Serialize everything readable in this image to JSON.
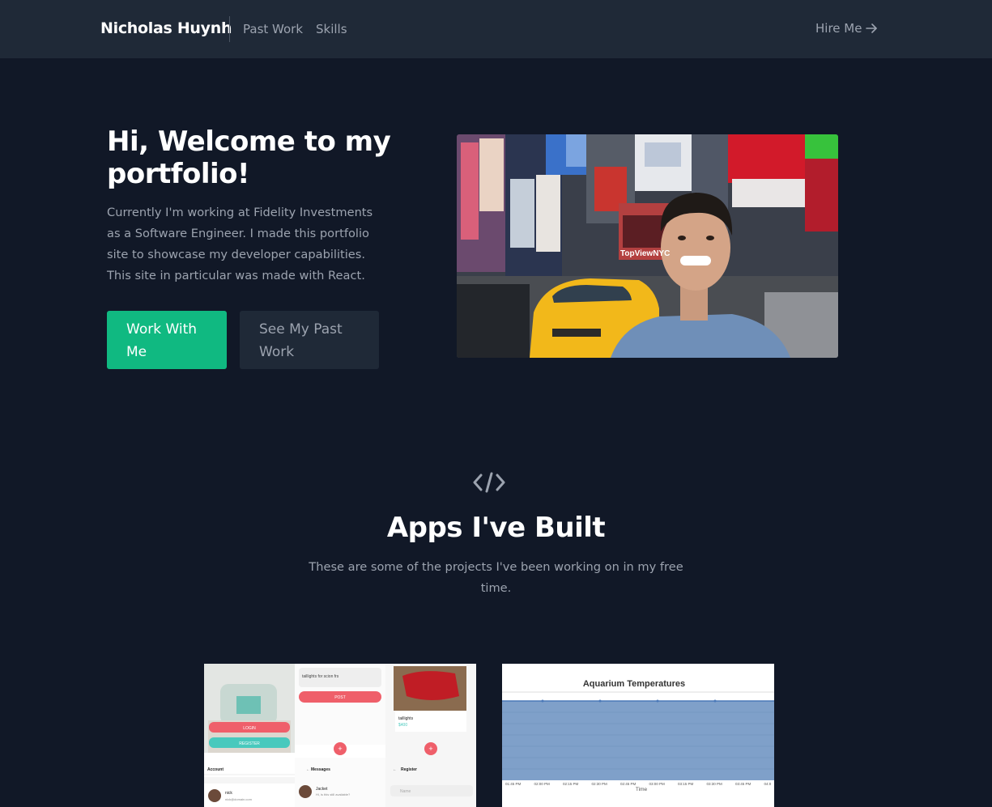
{
  "nav": {
    "brand": "Nicholas Huynh",
    "links": [
      "Past Work",
      "Skills"
    ],
    "cta": "Hire Me"
  },
  "hero": {
    "title": "Hi, Welcome to my portfolio!",
    "description": "Currently I'm working at Fidelity Investments as a Software Engineer. I made this portfolio site to showcase my developer capabilities. This site in particular was made with React.",
    "primary_button": "Work With Me",
    "secondary_button": "See My Past Work",
    "photo_sign": "TopViewNYC"
  },
  "apps": {
    "title": "Apps I've Built",
    "subtitle": "These are some of the projects I've been working on in my free time.",
    "card1": {
      "search_text": "taillights for scion frs",
      "post": "POST",
      "login": "LOGIN",
      "register": "REGISTER",
      "item": "taillights",
      "price": "$400",
      "account": "Account",
      "messages": "Messages",
      "register_title": "Register",
      "user": "nick",
      "email": "nick@domain.com",
      "contact": "Jacket",
      "message": "Hi, is this still available?",
      "name_ph": "Name"
    },
    "card2": {
      "chart_title": "Aquarium Temperatures",
      "xlabel": "Time",
      "ticks": [
        "01:45 PM",
        "02:00 PM",
        "02:15 PM",
        "02:30 PM",
        "02:45 PM",
        "03:00 PM",
        "03:15 PM",
        "03:30 PM",
        "03:45 PM",
        "04:0"
      ]
    }
  },
  "colors": {
    "background": "#111827",
    "nav": "#1f2937",
    "accent": "#10b981"
  }
}
